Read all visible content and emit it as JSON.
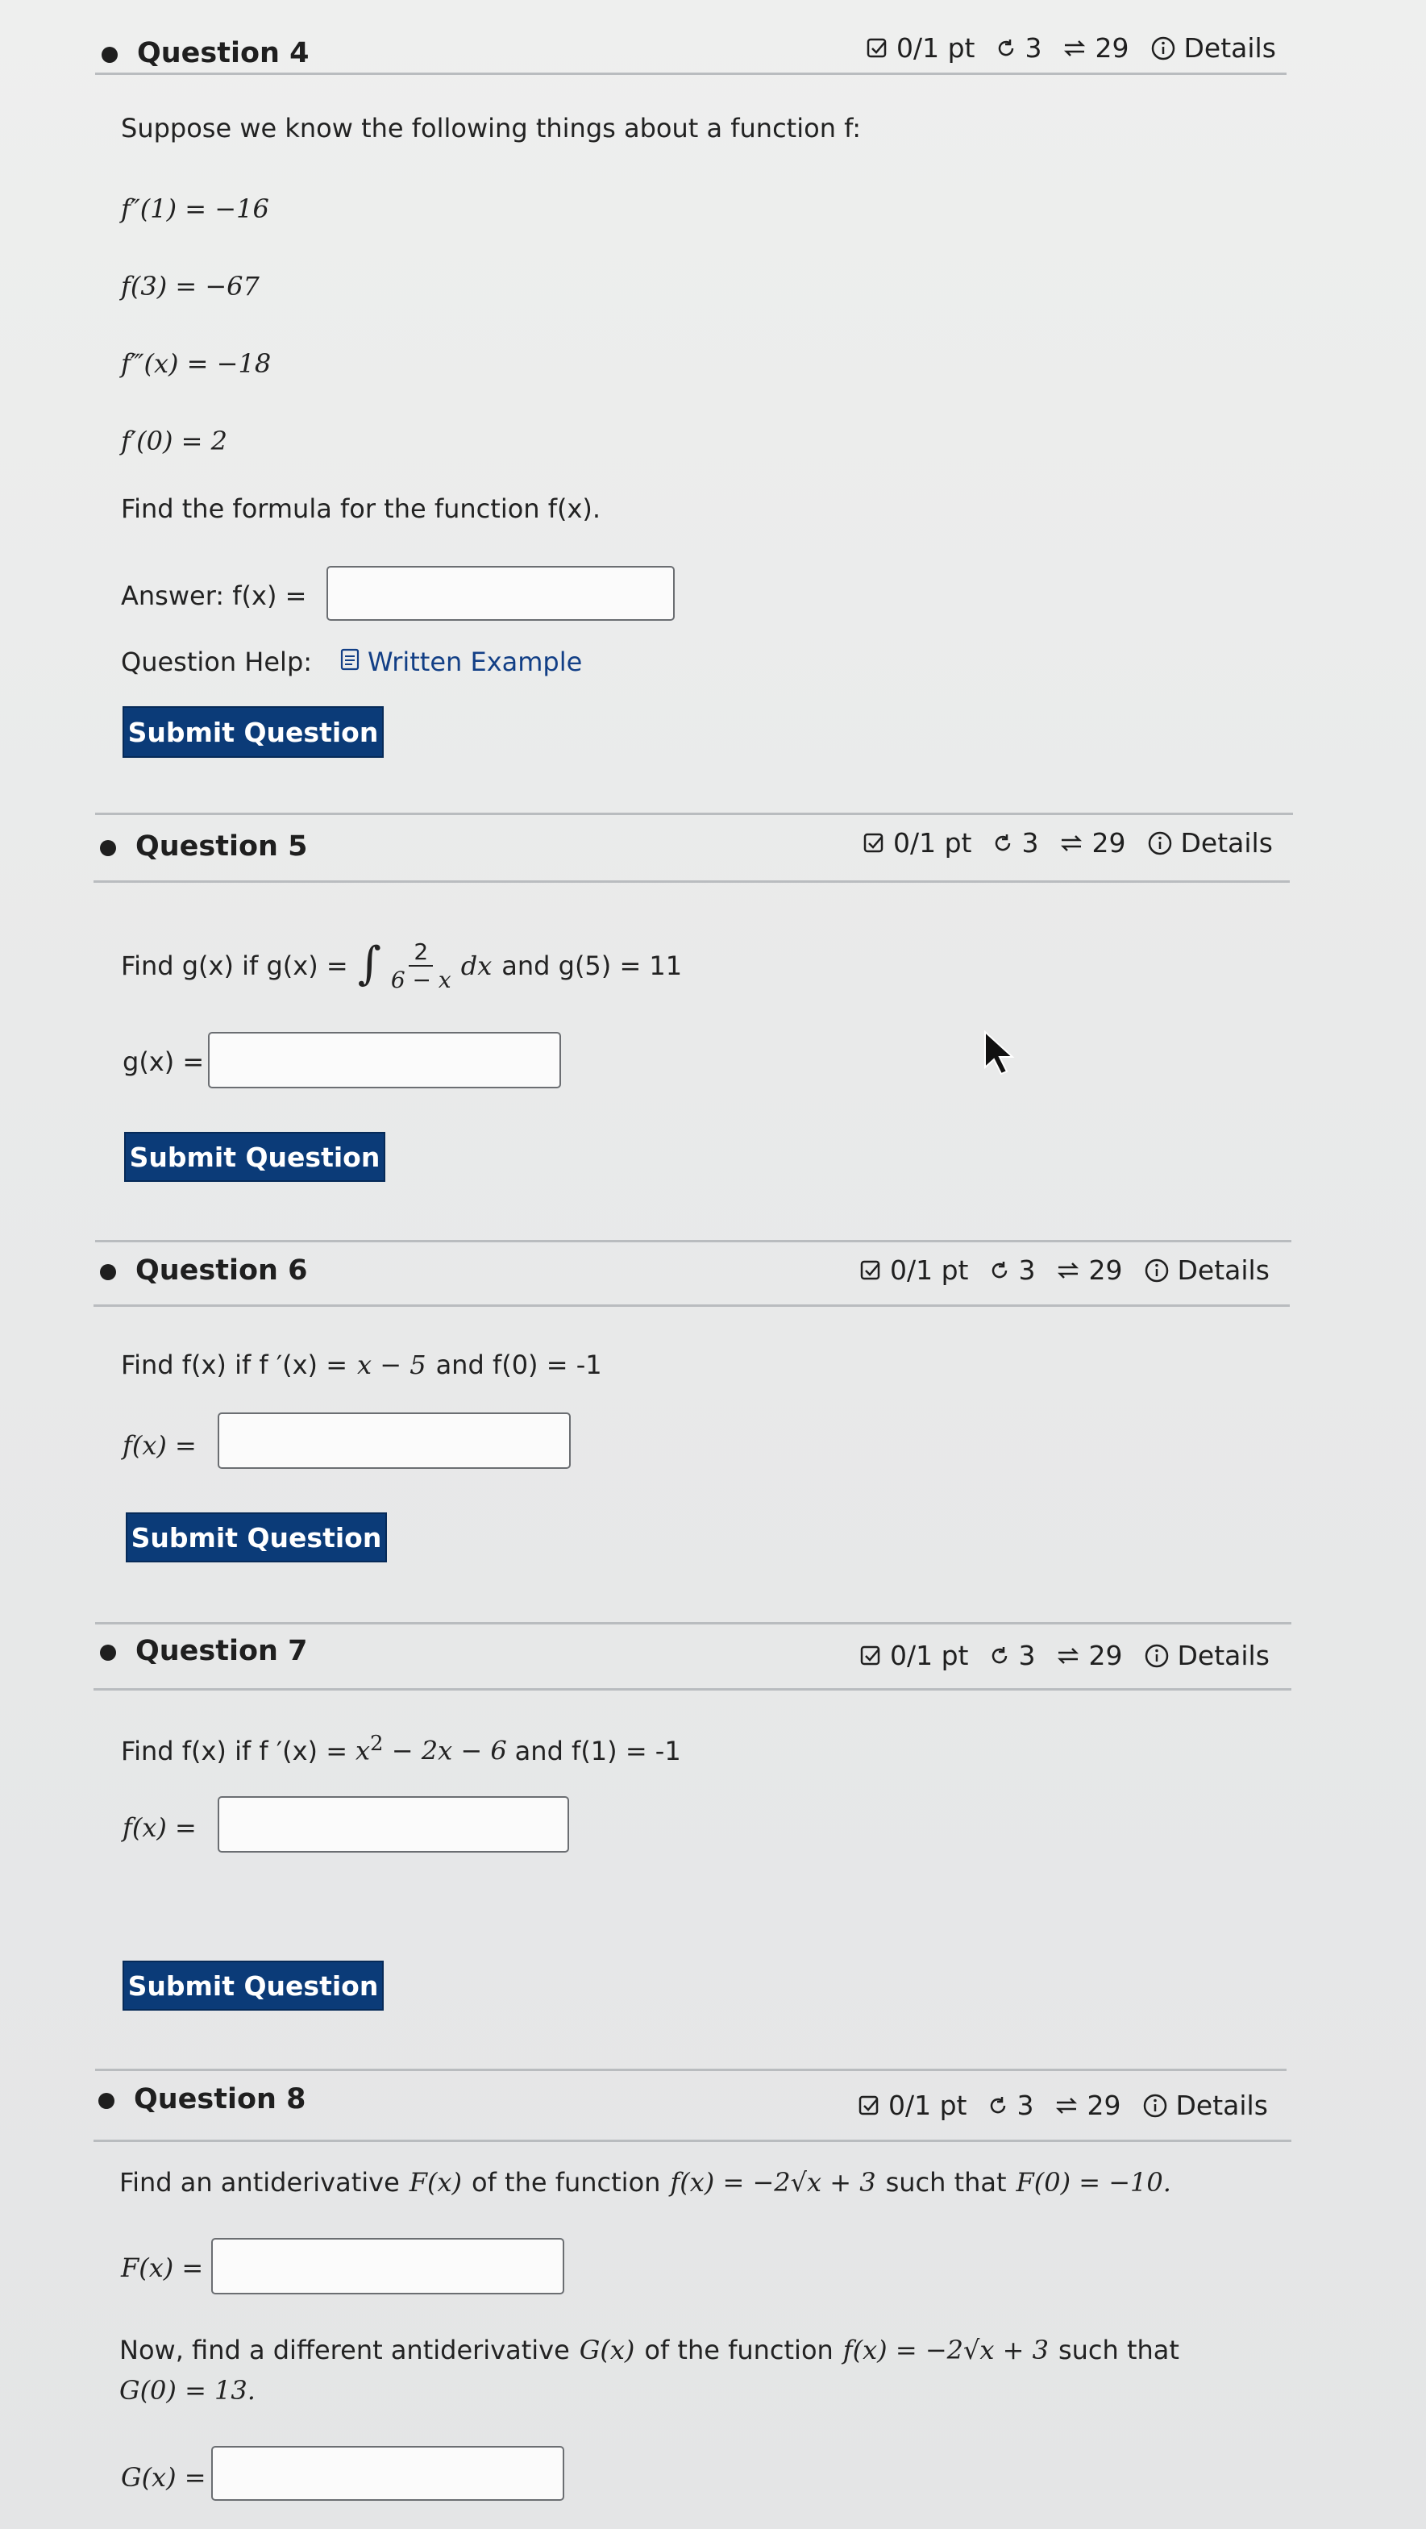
{
  "questions": [
    {
      "title": "Question 4",
      "meta": {
        "score": "0/1 pt",
        "retries": "3",
        "attempts": "29",
        "details": "Details"
      },
      "prompt": "Suppose we know the following things about a function f:",
      "facts": [
        "f″(1) = −16",
        "f(3) = −67",
        "f‴(x) = −18",
        "f′(0) = 2"
      ],
      "find": "Find the formula for the function f(x).",
      "answer_label": "Answer:  f(x) =",
      "help_label": "Question Help:",
      "help_link": "Written Example",
      "submit_label": "Submit Question"
    },
    {
      "title": "Question 5",
      "meta": {
        "score": "0/1 pt",
        "retries": "3",
        "attempts": "29",
        "details": "Details"
      },
      "prompt_a": "Find g(x) if g(x) =",
      "integral_num": "2",
      "integral_den": "6 − x",
      "integral_dx": "dx",
      "prompt_b": "and g(5) = 11",
      "answer_label": "g(x) =",
      "submit_label": "Submit Question"
    },
    {
      "title": "Question 6",
      "meta": {
        "score": "0/1 pt",
        "retries": "3",
        "attempts": "29",
        "details": "Details"
      },
      "prompt_a": "Find f(x) if f ′(x) =",
      "expr": "x − 5",
      "prompt_b": "and f(0) = -1",
      "answer_label": "f(x) =",
      "submit_label": "Submit Question"
    },
    {
      "title": "Question 7",
      "meta": {
        "score": "0/1 pt",
        "retries": "3",
        "attempts": "29",
        "details": "Details"
      },
      "prompt_a": "Find f(x) if f ′(x) =",
      "expr_base": "x",
      "expr_sup": "2",
      "expr_rest": "− 2x − 6",
      "prompt_b": "and f(1) = -1",
      "answer_label": "f(x) =",
      "submit_label": "Submit Question"
    },
    {
      "title": "Question 8",
      "meta": {
        "score": "0/1 pt",
        "retries": "3",
        "attempts": "29",
        "details": "Details"
      },
      "prompt_a1": "Find an antiderivative",
      "prompt_a2": "F(x)",
      "prompt_a3": "of the function",
      "prompt_a4": "f(x) = −2√x + 3",
      "prompt_a5": "such that",
      "prompt_a6": "F(0) = −10.",
      "answer_label_1": "F(x) =",
      "prompt_b1": "Now, find a different antiderivative",
      "prompt_b2": "G(x)",
      "prompt_b3": "of the function",
      "prompt_b4": "f(x) = −2√x + 3",
      "prompt_b5": "such that",
      "prompt_b6": "G(0) = 13.",
      "answer_label_2": "G(x) ="
    }
  ],
  "colors": {
    "button": "#0b3b78",
    "link": "#123f86",
    "rule": "#b9bcbf"
  },
  "icons": [
    "score-checkbox-icon",
    "retry-icon",
    "attempts-icon",
    "info-icon",
    "document-icon",
    "mouse-cursor-icon"
  ]
}
